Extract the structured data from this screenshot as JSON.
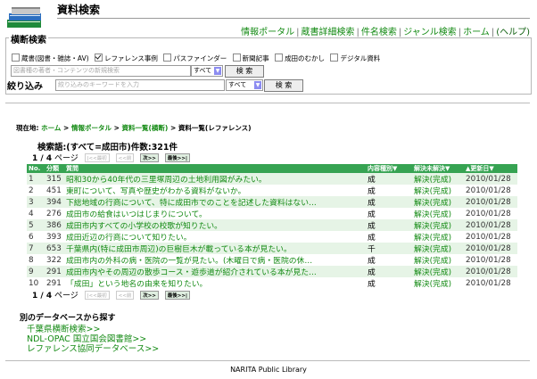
{
  "header": {
    "title": "資料検索",
    "nav": [
      "情報ポータル",
      "蔵書詳細検索",
      "件名検索",
      "ジャンル検索",
      "ホーム"
    ],
    "help": "(ヘルプ)"
  },
  "search_box": {
    "legend": "横断検索",
    "checkboxes": [
      {
        "label": "蔵書(図書・雑誌・AV)",
        "checked": false
      },
      {
        "label": "レファレンス事例",
        "checked": true
      },
      {
        "label": "パスファインダー",
        "checked": false
      },
      {
        "label": "新聞記事",
        "checked": false
      },
      {
        "label": "成田のむかし",
        "checked": false
      },
      {
        "label": "デジタル資料",
        "checked": false
      }
    ],
    "input_placeholder": "図書種の著者・コンテンツの新規検索",
    "select_value": "すべて",
    "button_label": "検 索"
  },
  "refine": {
    "label": "絞り込み",
    "input_placeholder": "絞り込みのキーワードを入力",
    "select_value": "すべて",
    "button_label": "検 索"
  },
  "breadcrumb": {
    "prefix": "現在地:",
    "items": [
      "ホーム",
      "情報ポータル",
      "資料一覧(横断)",
      "資料一覧(レファレンス)"
    ],
    "sep": ">"
  },
  "query": {
    "text": "検索語:(すべて=成田市)件数:321件"
  },
  "pager": {
    "page": "1 / 4",
    "label": "ページ",
    "first": "|<<最初",
    "prev": "<<前",
    "next": "次>>",
    "last": "最後>>|"
  },
  "table": {
    "headers": [
      "No.",
      "分類",
      "質問",
      "内容種別▼",
      "解決未解決▼",
      "▲更新日▼"
    ],
    "rows": [
      {
        "no": "1",
        "cls": "315",
        "q": "昭和30から40年代の三里塚周辺の土地利用図がみたい。",
        "kind": "成",
        "status": "解決(完成)",
        "date": "2010/01/28"
      },
      {
        "no": "2",
        "cls": "451",
        "q": "東町について、写真や歴史がわかる資料がないか。",
        "kind": "成",
        "status": "解決(完成)",
        "date": "2010/01/28"
      },
      {
        "no": "3",
        "cls": "394",
        "q": "下総地域の行商について、特に成田市でのことを記述した資料はない…",
        "kind": "成",
        "status": "解決(完成)",
        "date": "2010/01/28"
      },
      {
        "no": "4",
        "cls": "276",
        "q": "成田市の給食はいつはじまりについて。",
        "kind": "成",
        "status": "解決(完成)",
        "date": "2010/01/28"
      },
      {
        "no": "5",
        "cls": "386",
        "q": "成田市内すべての小学校の校歌が知りたい。",
        "kind": "成",
        "status": "解決(完成)",
        "date": "2010/01/28"
      },
      {
        "no": "6",
        "cls": "393",
        "q": "成田近辺の行商について知りたい。",
        "kind": "成",
        "status": "解決(完成)",
        "date": "2010/01/28"
      },
      {
        "no": "7",
        "cls": "653",
        "q": "千葉県内(特に成田市周辺)の巨樹巨木が載っている本が見たい。",
        "kind": "千",
        "status": "解決(完成)",
        "date": "2010/01/28"
      },
      {
        "no": "8",
        "cls": "322",
        "q": "成田市内の外科の病・医院の一覧が見たい。(木曜日で病・医院の休…",
        "kind": "成",
        "status": "解決(完成)",
        "date": "2010/01/28"
      },
      {
        "no": "9",
        "cls": "291",
        "q": "成田市内やその周辺の散歩コース・遊歩道が紹介されている本が見た…",
        "kind": "成",
        "status": "解決(完成)",
        "date": "2010/01/28"
      },
      {
        "no": "10",
        "cls": "291",
        "q": "「成田」という地名の由来を知りたい。",
        "kind": "成",
        "status": "解決(完成)",
        "date": "2010/01/28"
      }
    ]
  },
  "other_db": {
    "title": "別のデータベースから探す",
    "links": [
      "千葉県横断検索>>",
      "NDL-OPAC 国立国会図書館>>",
      "レファレンス協同データベース>>"
    ]
  },
  "footer": {
    "text": "NARITA Public Library"
  },
  "colors": {
    "accent": "#138a13",
    "table_header": "#36a352",
    "row_alt": "#e6f4e6"
  }
}
